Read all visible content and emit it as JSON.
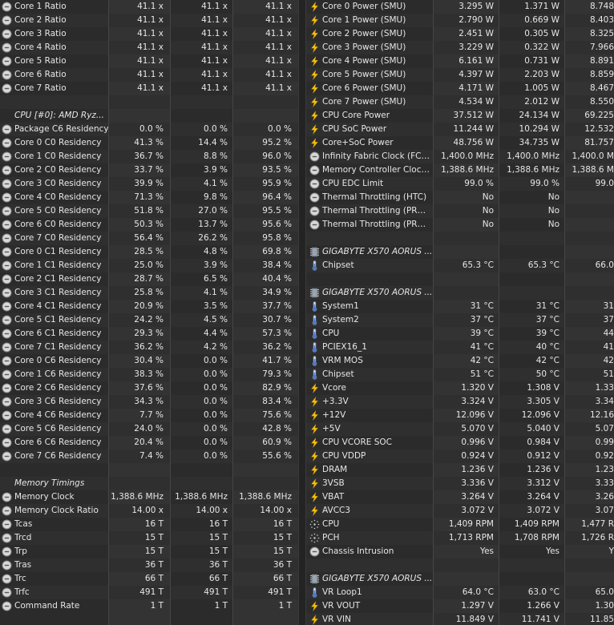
{
  "left": [
    {
      "t": "row",
      "label": "Core 1 Ratio",
      "vals": [
        "41.1 x",
        "41.1 x",
        "41.1 x"
      ]
    },
    {
      "t": "row",
      "label": "Core 2 Ratio",
      "vals": [
        "41.1 x",
        "41.1 x",
        "41.1 x"
      ]
    },
    {
      "t": "row",
      "label": "Core 3 Ratio",
      "vals": [
        "41.1 x",
        "41.1 x",
        "41.1 x"
      ]
    },
    {
      "t": "row",
      "label": "Core 4 Ratio",
      "vals": [
        "41.1 x",
        "41.1 x",
        "41.1 x"
      ]
    },
    {
      "t": "row",
      "label": "Core 5 Ratio",
      "vals": [
        "41.1 x",
        "41.1 x",
        "41.1 x"
      ]
    },
    {
      "t": "row",
      "label": "Core 6 Ratio",
      "vals": [
        "41.1 x",
        "41.1 x",
        "41.1 x"
      ]
    },
    {
      "t": "row",
      "label": "Core 7 Ratio",
      "vals": [
        "41.1 x",
        "41.1 x",
        "41.1 x"
      ]
    },
    {
      "t": "blank"
    },
    {
      "t": "hdr",
      "label": "CPU [#0]: AMD Ryz...",
      "icon": "none"
    },
    {
      "t": "row",
      "label": "Package C6 Residency",
      "vals": [
        "0.0 %",
        "0.0 %",
        "0.0 %"
      ]
    },
    {
      "t": "row",
      "label": "Core 0 C0 Residency",
      "vals": [
        "41.3 %",
        "14.4 %",
        "95.2 %"
      ]
    },
    {
      "t": "row",
      "label": "Core 1 C0 Residency",
      "vals": [
        "36.7 %",
        "8.8 %",
        "96.0 %"
      ]
    },
    {
      "t": "row",
      "label": "Core 2 C0 Residency",
      "vals": [
        "33.7 %",
        "3.9 %",
        "93.5 %"
      ]
    },
    {
      "t": "row",
      "label": "Core 3 C0 Residency",
      "vals": [
        "39.9 %",
        "4.1 %",
        "95.9 %"
      ]
    },
    {
      "t": "row",
      "label": "Core 4 C0 Residency",
      "vals": [
        "71.3 %",
        "9.8 %",
        "96.4 %"
      ]
    },
    {
      "t": "row",
      "label": "Core 5 C0 Residency",
      "vals": [
        "51.8 %",
        "27.0 %",
        "95.5 %"
      ]
    },
    {
      "t": "row",
      "label": "Core 6 C0 Residency",
      "vals": [
        "50.3 %",
        "13.7 %",
        "95.6 %"
      ]
    },
    {
      "t": "row",
      "label": "Core 7 C0 Residency",
      "vals": [
        "56.4 %",
        "26.2 %",
        "95.8 %"
      ]
    },
    {
      "t": "row",
      "label": "Core 0 C1 Residency",
      "vals": [
        "28.5 %",
        "4.8 %",
        "69.8 %"
      ]
    },
    {
      "t": "row",
      "label": "Core 1 C1 Residency",
      "vals": [
        "25.0 %",
        "3.9 %",
        "38.4 %"
      ]
    },
    {
      "t": "row",
      "label": "Core 2 C1 Residency",
      "vals": [
        "28.7 %",
        "6.5 %",
        "40.4 %"
      ]
    },
    {
      "t": "row",
      "label": "Core 3 C1 Residency",
      "vals": [
        "25.8 %",
        "4.1 %",
        "34.9 %"
      ]
    },
    {
      "t": "row",
      "label": "Core 4 C1 Residency",
      "vals": [
        "20.9 %",
        "3.5 %",
        "37.7 %"
      ]
    },
    {
      "t": "row",
      "label": "Core 5 C1 Residency",
      "vals": [
        "24.2 %",
        "4.5 %",
        "30.7 %"
      ]
    },
    {
      "t": "row",
      "label": "Core 6 C1 Residency",
      "vals": [
        "29.3 %",
        "4.4 %",
        "57.3 %"
      ]
    },
    {
      "t": "row",
      "label": "Core 7 C1 Residency",
      "vals": [
        "36.2 %",
        "4.2 %",
        "36.2 %"
      ]
    },
    {
      "t": "row",
      "label": "Core 0 C6 Residency",
      "vals": [
        "30.4 %",
        "0.0 %",
        "41.7 %"
      ]
    },
    {
      "t": "row",
      "label": "Core 1 C6 Residency",
      "vals": [
        "38.3 %",
        "0.0 %",
        "79.3 %"
      ]
    },
    {
      "t": "row",
      "label": "Core 2 C6 Residency",
      "vals": [
        "37.6 %",
        "0.0 %",
        "82.9 %"
      ]
    },
    {
      "t": "row",
      "label": "Core 3 C6 Residency",
      "vals": [
        "34.3 %",
        "0.0 %",
        "83.4 %"
      ]
    },
    {
      "t": "row",
      "label": "Core 4 C6 Residency",
      "vals": [
        "7.7 %",
        "0.0 %",
        "75.6 %"
      ]
    },
    {
      "t": "row",
      "label": "Core 5 C6 Residency",
      "vals": [
        "24.0 %",
        "0.0 %",
        "42.8 %"
      ]
    },
    {
      "t": "row",
      "label": "Core 6 C6 Residency",
      "vals": [
        "20.4 %",
        "0.0 %",
        "60.9 %"
      ]
    },
    {
      "t": "row",
      "label": "Core 7 C6 Residency",
      "vals": [
        "7.4 %",
        "0.0 %",
        "55.6 %"
      ]
    },
    {
      "t": "blank"
    },
    {
      "t": "hdr",
      "label": "Memory Timings",
      "icon": "none"
    },
    {
      "t": "row",
      "label": "Memory Clock",
      "vals": [
        "1,388.6 MHz",
        "1,388.6 MHz",
        "1,388.6 MHz"
      ]
    },
    {
      "t": "row",
      "label": "Memory Clock Ratio",
      "vals": [
        "14.00 x",
        "14.00 x",
        "14.00 x"
      ]
    },
    {
      "t": "row",
      "label": "Tcas",
      "vals": [
        "16 T",
        "16 T",
        "16 T"
      ]
    },
    {
      "t": "row",
      "label": "Trcd",
      "vals": [
        "15 T",
        "15 T",
        "15 T"
      ]
    },
    {
      "t": "row",
      "label": "Trp",
      "vals": [
        "15 T",
        "15 T",
        "15 T"
      ]
    },
    {
      "t": "row",
      "label": "Tras",
      "vals": [
        "36 T",
        "36 T",
        "36 T"
      ]
    },
    {
      "t": "row",
      "label": "Trc",
      "vals": [
        "66 T",
        "66 T",
        "66 T"
      ]
    },
    {
      "t": "row",
      "label": "Trfc",
      "vals": [
        "491 T",
        "491 T",
        "491 T"
      ]
    },
    {
      "t": "row",
      "label": "Command Rate",
      "vals": [
        "1 T",
        "1 T",
        "1 T"
      ]
    }
  ],
  "right": [
    {
      "t": "row",
      "icon": "bolt",
      "label": "Core 0 Power (SMU)",
      "vals": [
        "3.295 W",
        "1.371 W",
        "8.748"
      ]
    },
    {
      "t": "row",
      "icon": "bolt",
      "label": "Core 1 Power (SMU)",
      "vals": [
        "2.790 W",
        "0.669 W",
        "8.403"
      ]
    },
    {
      "t": "row",
      "icon": "bolt",
      "label": "Core 2 Power (SMU)",
      "vals": [
        "2.451 W",
        "0.305 W",
        "8.325"
      ]
    },
    {
      "t": "row",
      "icon": "bolt",
      "label": "Core 3 Power (SMU)",
      "vals": [
        "3.229 W",
        "0.322 W",
        "7.966"
      ]
    },
    {
      "t": "row",
      "icon": "bolt",
      "label": "Core 4 Power (SMU)",
      "vals": [
        "6.161 W",
        "0.731 W",
        "8.891"
      ]
    },
    {
      "t": "row",
      "icon": "bolt",
      "label": "Core 5 Power (SMU)",
      "vals": [
        "4.397 W",
        "2.203 W",
        "8.859"
      ]
    },
    {
      "t": "row",
      "icon": "bolt",
      "label": "Core 6 Power (SMU)",
      "vals": [
        "4.171 W",
        "1.005 W",
        "8.467"
      ]
    },
    {
      "t": "row",
      "icon": "bolt",
      "label": "Core 7 Power (SMU)",
      "vals": [
        "4.534 W",
        "2.012 W",
        "8.550"
      ]
    },
    {
      "t": "row",
      "icon": "bolt",
      "label": "CPU Core Power",
      "vals": [
        "37.512 W",
        "24.134 W",
        "69.225"
      ]
    },
    {
      "t": "row",
      "icon": "bolt",
      "label": "CPU SoC Power",
      "vals": [
        "11.244 W",
        "10.294 W",
        "12.532"
      ]
    },
    {
      "t": "row",
      "icon": "bolt",
      "label": "Core+SoC Power",
      "vals": [
        "48.756 W",
        "34.735 W",
        "81.757"
      ]
    },
    {
      "t": "row",
      "icon": "circle",
      "label": "Infinity Fabric Clock (FCLK)",
      "vals": [
        "1,400.0 MHz",
        "1,400.0 MHz",
        "1,400.0 M"
      ]
    },
    {
      "t": "row",
      "icon": "circle",
      "label": "Memory Controller Clock ...",
      "vals": [
        "1,388.6 MHz",
        "1,388.6 MHz",
        "1,388.6 M"
      ]
    },
    {
      "t": "row",
      "icon": "circle",
      "label": "CPU EDC Limit",
      "vals": [
        "99.0 %",
        "99.0 %",
        "99.0"
      ]
    },
    {
      "t": "row",
      "icon": "circle",
      "label": "Thermal Throttling (HTC)",
      "vals": [
        "No",
        "No",
        ""
      ]
    },
    {
      "t": "row",
      "icon": "circle",
      "label": "Thermal Throttling (PROC...",
      "vals": [
        "No",
        "No",
        ""
      ]
    },
    {
      "t": "row",
      "icon": "circle",
      "label": "Thermal Throttling (PROC...",
      "vals": [
        "No",
        "No",
        ""
      ]
    },
    {
      "t": "blank"
    },
    {
      "t": "hdr",
      "label": "GIGABYTE X570 AORUS ...",
      "icon": "chip"
    },
    {
      "t": "row",
      "icon": "therm",
      "label": "Chipset",
      "vals": [
        "65.3 °C",
        "65.3 °C",
        "66.0"
      ]
    },
    {
      "t": "blank"
    },
    {
      "t": "hdr",
      "label": "GIGABYTE X570 AORUS ...",
      "icon": "chip"
    },
    {
      "t": "row",
      "icon": "therm",
      "label": "System1",
      "vals": [
        "31 °C",
        "31 °C",
        "31"
      ]
    },
    {
      "t": "row",
      "icon": "therm",
      "label": "System2",
      "vals": [
        "37 °C",
        "37 °C",
        "37"
      ]
    },
    {
      "t": "row",
      "icon": "therm",
      "label": "CPU",
      "vals": [
        "39 °C",
        "39 °C",
        "44"
      ]
    },
    {
      "t": "row",
      "icon": "therm",
      "label": "PCIEX16_1",
      "vals": [
        "41 °C",
        "40 °C",
        "41"
      ]
    },
    {
      "t": "row",
      "icon": "therm",
      "label": "VRM MOS",
      "vals": [
        "42 °C",
        "42 °C",
        "42"
      ]
    },
    {
      "t": "row",
      "icon": "therm",
      "label": "Chipset",
      "vals": [
        "51 °C",
        "50 °C",
        "51"
      ]
    },
    {
      "t": "row",
      "icon": "bolt",
      "label": "Vcore",
      "vals": [
        "1.320 V",
        "1.308 V",
        "1.33"
      ]
    },
    {
      "t": "row",
      "icon": "bolt",
      "label": "+3.3V",
      "vals": [
        "3.324 V",
        "3.305 V",
        "3.34"
      ]
    },
    {
      "t": "row",
      "icon": "bolt",
      "label": "+12V",
      "vals": [
        "12.096 V",
        "12.096 V",
        "12.16"
      ]
    },
    {
      "t": "row",
      "icon": "bolt",
      "label": "+5V",
      "vals": [
        "5.070 V",
        "5.040 V",
        "5.07"
      ]
    },
    {
      "t": "row",
      "icon": "bolt",
      "label": "CPU VCORE SOC",
      "vals": [
        "0.996 V",
        "0.984 V",
        "0.99"
      ]
    },
    {
      "t": "row",
      "icon": "bolt",
      "label": "CPU VDDP",
      "vals": [
        "0.924 V",
        "0.912 V",
        "0.92"
      ]
    },
    {
      "t": "row",
      "icon": "bolt",
      "label": "DRAM",
      "vals": [
        "1.236 V",
        "1.236 V",
        "1.23"
      ]
    },
    {
      "t": "row",
      "icon": "bolt",
      "label": "3VSB",
      "vals": [
        "3.336 V",
        "3.312 V",
        "3.33"
      ]
    },
    {
      "t": "row",
      "icon": "bolt",
      "label": "VBAT",
      "vals": [
        "3.264 V",
        "3.264 V",
        "3.26"
      ]
    },
    {
      "t": "row",
      "icon": "bolt",
      "label": "AVCC3",
      "vals": [
        "3.072 V",
        "3.072 V",
        "3.07"
      ]
    },
    {
      "t": "row",
      "icon": "fan",
      "label": "CPU",
      "vals": [
        "1,409 RPM",
        "1,409 RPM",
        "1,477 R"
      ]
    },
    {
      "t": "row",
      "icon": "fan",
      "label": "PCH",
      "vals": [
        "1,713 RPM",
        "1,708 RPM",
        "1,726 R"
      ]
    },
    {
      "t": "row",
      "icon": "circle",
      "label": "Chassis Intrusion",
      "vals": [
        "Yes",
        "Yes",
        "Y"
      ]
    },
    {
      "t": "blank"
    },
    {
      "t": "hdr",
      "label": "GIGABYTE X570 AORUS ...",
      "icon": "chip"
    },
    {
      "t": "row",
      "icon": "therm",
      "label": "VR Loop1",
      "vals": [
        "64.0 °C",
        "63.0 °C",
        "65.0"
      ]
    },
    {
      "t": "row",
      "icon": "bolt",
      "label": "VR VOUT",
      "vals": [
        "1.297 V",
        "1.266 V",
        "1.30"
      ]
    },
    {
      "t": "row",
      "icon": "bolt",
      "label": "VR VIN",
      "vals": [
        "11.849 V",
        "11.741 V",
        "11.85"
      ]
    }
  ]
}
